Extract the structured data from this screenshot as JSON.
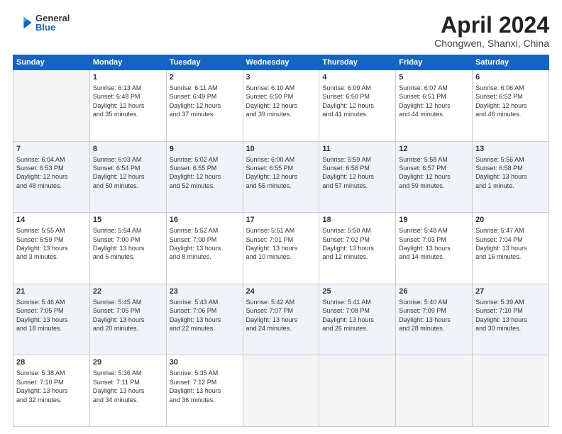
{
  "header": {
    "logo_general": "General",
    "logo_blue": "Blue",
    "month_title": "April 2024",
    "subtitle": "Chongwen, Shanxi, China"
  },
  "days_of_week": [
    "Sunday",
    "Monday",
    "Tuesday",
    "Wednesday",
    "Thursday",
    "Friday",
    "Saturday"
  ],
  "weeks": [
    [
      {
        "day": "",
        "info": ""
      },
      {
        "day": "1",
        "info": "Sunrise: 6:13 AM\nSunset: 6:48 PM\nDaylight: 12 hours\nand 35 minutes."
      },
      {
        "day": "2",
        "info": "Sunrise: 6:11 AM\nSunset: 6:49 PM\nDaylight: 12 hours\nand 37 minutes."
      },
      {
        "day": "3",
        "info": "Sunrise: 6:10 AM\nSunset: 6:50 PM\nDaylight: 12 hours\nand 39 minutes."
      },
      {
        "day": "4",
        "info": "Sunrise: 6:09 AM\nSunset: 6:50 PM\nDaylight: 12 hours\nand 41 minutes."
      },
      {
        "day": "5",
        "info": "Sunrise: 6:07 AM\nSunset: 6:51 PM\nDaylight: 12 hours\nand 44 minutes."
      },
      {
        "day": "6",
        "info": "Sunrise: 6:06 AM\nSunset: 6:52 PM\nDaylight: 12 hours\nand 46 minutes."
      }
    ],
    [
      {
        "day": "7",
        "info": "Sunrise: 6:04 AM\nSunset: 6:53 PM\nDaylight: 12 hours\nand 48 minutes."
      },
      {
        "day": "8",
        "info": "Sunrise: 6:03 AM\nSunset: 6:54 PM\nDaylight: 12 hours\nand 50 minutes."
      },
      {
        "day": "9",
        "info": "Sunrise: 6:02 AM\nSunset: 6:55 PM\nDaylight: 12 hours\nand 52 minutes."
      },
      {
        "day": "10",
        "info": "Sunrise: 6:00 AM\nSunset: 6:55 PM\nDaylight: 12 hours\nand 55 minutes."
      },
      {
        "day": "11",
        "info": "Sunrise: 5:59 AM\nSunset: 6:56 PM\nDaylight: 12 hours\nand 57 minutes."
      },
      {
        "day": "12",
        "info": "Sunrise: 5:58 AM\nSunset: 6:57 PM\nDaylight: 12 hours\nand 59 minutes."
      },
      {
        "day": "13",
        "info": "Sunrise: 5:56 AM\nSunset: 6:58 PM\nDaylight: 13 hours\nand 1 minute."
      }
    ],
    [
      {
        "day": "14",
        "info": "Sunrise: 5:55 AM\nSunset: 6:59 PM\nDaylight: 13 hours\nand 3 minutes."
      },
      {
        "day": "15",
        "info": "Sunrise: 5:54 AM\nSunset: 7:00 PM\nDaylight: 13 hours\nand 6 minutes."
      },
      {
        "day": "16",
        "info": "Sunrise: 5:52 AM\nSunset: 7:00 PM\nDaylight: 13 hours\nand 8 minutes."
      },
      {
        "day": "17",
        "info": "Sunrise: 5:51 AM\nSunset: 7:01 PM\nDaylight: 13 hours\nand 10 minutes."
      },
      {
        "day": "18",
        "info": "Sunrise: 5:50 AM\nSunset: 7:02 PM\nDaylight: 13 hours\nand 12 minutes."
      },
      {
        "day": "19",
        "info": "Sunrise: 5:48 AM\nSunset: 7:03 PM\nDaylight: 13 hours\nand 14 minutes."
      },
      {
        "day": "20",
        "info": "Sunrise: 5:47 AM\nSunset: 7:04 PM\nDaylight: 13 hours\nand 16 minutes."
      }
    ],
    [
      {
        "day": "21",
        "info": "Sunrise: 5:46 AM\nSunset: 7:05 PM\nDaylight: 13 hours\nand 18 minutes."
      },
      {
        "day": "22",
        "info": "Sunrise: 5:45 AM\nSunset: 7:05 PM\nDaylight: 13 hours\nand 20 minutes."
      },
      {
        "day": "23",
        "info": "Sunrise: 5:43 AM\nSunset: 7:06 PM\nDaylight: 13 hours\nand 22 minutes."
      },
      {
        "day": "24",
        "info": "Sunrise: 5:42 AM\nSunset: 7:07 PM\nDaylight: 13 hours\nand 24 minutes."
      },
      {
        "day": "25",
        "info": "Sunrise: 5:41 AM\nSunset: 7:08 PM\nDaylight: 13 hours\nand 26 minutes."
      },
      {
        "day": "26",
        "info": "Sunrise: 5:40 AM\nSunset: 7:09 PM\nDaylight: 13 hours\nand 28 minutes."
      },
      {
        "day": "27",
        "info": "Sunrise: 5:39 AM\nSunset: 7:10 PM\nDaylight: 13 hours\nand 30 minutes."
      }
    ],
    [
      {
        "day": "28",
        "info": "Sunrise: 5:38 AM\nSunset: 7:10 PM\nDaylight: 13 hours\nand 32 minutes."
      },
      {
        "day": "29",
        "info": "Sunrise: 5:36 AM\nSunset: 7:11 PM\nDaylight: 13 hours\nand 34 minutes."
      },
      {
        "day": "30",
        "info": "Sunrise: 5:35 AM\nSunset: 7:12 PM\nDaylight: 13 hours\nand 36 minutes."
      },
      {
        "day": "",
        "info": ""
      },
      {
        "day": "",
        "info": ""
      },
      {
        "day": "",
        "info": ""
      },
      {
        "day": "",
        "info": ""
      }
    ]
  ]
}
